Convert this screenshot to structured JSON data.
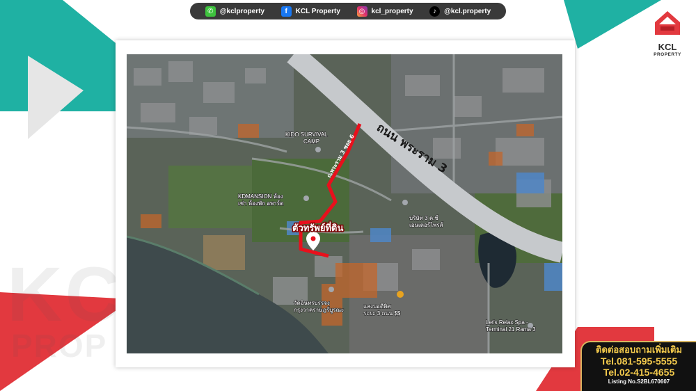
{
  "social": [
    {
      "icon": "line-icon",
      "handle": "@kclproperty"
    },
    {
      "icon": "facebook-icon",
      "handle": "KCL Property"
    },
    {
      "icon": "instagram-icon",
      "handle": "kcl_property"
    },
    {
      "icon": "tiktok-icon",
      "handle": "@kcl.property"
    }
  ],
  "brand": {
    "name": "KCL",
    "sub": "PROPERTY",
    "watermark_1": "KCL",
    "watermark_2": "PROP",
    "colors": {
      "red": "#e2393f",
      "teal": "#1fb1a3",
      "dark": "#2b2b2b"
    }
  },
  "map": {
    "road_main": "ถนน พระราม 3",
    "soi_label": "ถ.พระราม 3 ซอย 6",
    "asset_label": "ตัวทรัพย์ที่ดิน",
    "places": [
      {
        "name": "KIDO SURVIVAL",
        "line2": "CAMP"
      },
      {
        "name": "KDMANSION ห้อง",
        "line2": "เช่า ห้องพัก อพาร์ต"
      },
      {
        "name": "วัดอินทรบรรจง",
        "line2": "กรุงวาคราษฎร์บูรณะ"
      },
      {
        "name": "Let's Relax Spa -",
        "line2": "Terminal 21 Rama 3"
      },
      {
        "name": "บริษัท 3 ค.ซี",
        "line2": "เอนเตอร์ไพรส์"
      },
      {
        "name": "แสงบอดีพิศ",
        "line2": "ระยะ 3 ถนน $$"
      }
    ],
    "route_color": "#e8101c",
    "road_color": "#c6c9cc"
  },
  "contact": {
    "title": "ติดต่อสอบถามเพิ่มเติม",
    "tel1": "Tel.081-595-5555",
    "tel2": "Tel.02-415-4655",
    "listing": "Listing No.S2BL670607"
  }
}
